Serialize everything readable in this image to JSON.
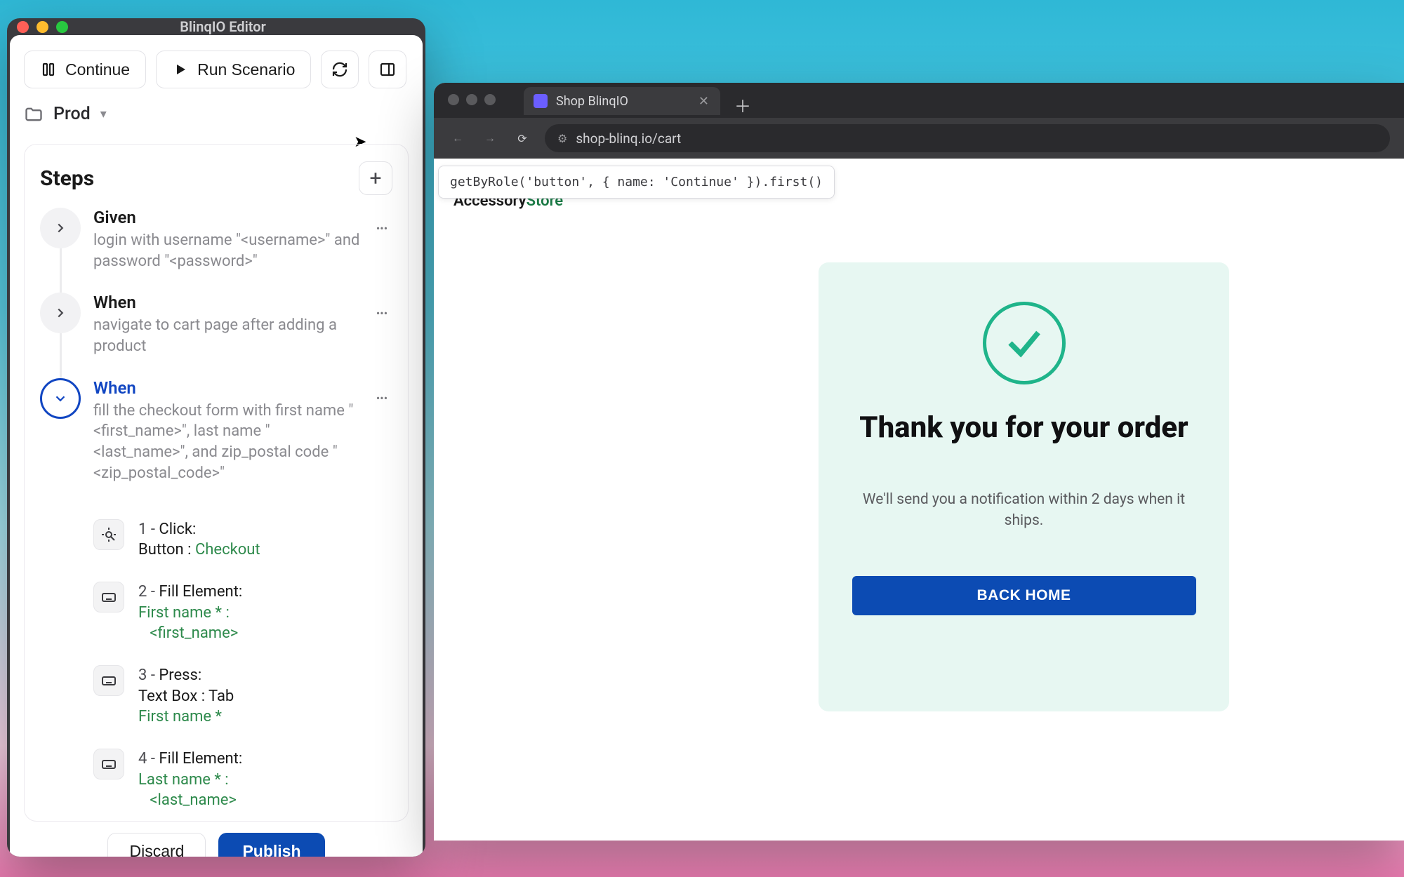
{
  "editor": {
    "title": "BlinqIO Editor",
    "toolbar": {
      "continue_label": "Continue",
      "run_label": "Run Scenario"
    },
    "env": {
      "name": "Prod"
    },
    "steps": {
      "title": "Steps",
      "items": [
        {
          "keyword": "Given",
          "desc": "login with username \"<username>\" and password \"<password>\"",
          "expanded": false,
          "active": false
        },
        {
          "keyword": "When",
          "desc": "navigate to cart page after adding a product",
          "expanded": false,
          "active": false
        },
        {
          "keyword": "When",
          "desc": "fill the checkout form with first name \"<first_name>\", last name \"<last_name>\", and zip_postal code \"<zip_postal_code>\"",
          "expanded": true,
          "active": true,
          "substeps": [
            {
              "n": "1",
              "kind": "click",
              "action": "Click:",
              "target_label": "Button :",
              "target_value": "Checkout"
            },
            {
              "n": "2",
              "kind": "type",
              "action": "Fill Element:",
              "target_label": "First name * :",
              "target_value": "<first_name>"
            },
            {
              "n": "3",
              "kind": "type",
              "action": "Press:",
              "target_label": "Text Box : Tab",
              "target_value": "First name *"
            },
            {
              "n": "4",
              "kind": "type",
              "action": "Fill Element:",
              "target_label": "Last name * :",
              "target_value": "<last_name>"
            }
          ]
        }
      ]
    },
    "footer": {
      "discard": "Discard",
      "publish": "Publish"
    }
  },
  "browser": {
    "tab_title": "Shop BlinqIO",
    "url": "shop-blinq.io/cart",
    "selector_tooltip": "getByRole('button', { name: 'Continue' }).first()",
    "logo": {
      "a": "Accessory",
      "b": "Store"
    },
    "confirm": {
      "title": "Thank you for your order",
      "subtitle": "We'll send you a notification within 2 days when it ships.",
      "button": "BACK HOME"
    }
  }
}
